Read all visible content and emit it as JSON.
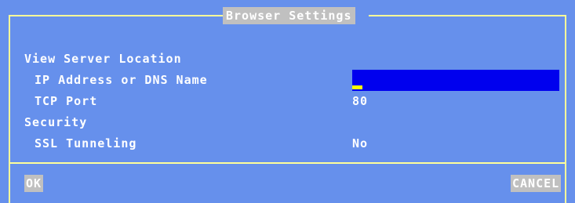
{
  "dialog": {
    "title": "Browser Settings"
  },
  "sections": {
    "view_server_location": "View Server Location",
    "security": "Security"
  },
  "fields": {
    "ip_label": "IP Address or DNS Name",
    "ip_value": "",
    "tcp_port_label": "TCP Port",
    "tcp_port_value": "80",
    "ssl_label": "SSL Tunneling",
    "ssl_value": "No"
  },
  "buttons": {
    "ok": "OK",
    "cancel": "CANCEL"
  },
  "colors": {
    "background": "#6690ec",
    "frame": "#ffff99",
    "input_field": "#0000ee",
    "caret": "#ffff00",
    "button": "#c0c0c0"
  }
}
